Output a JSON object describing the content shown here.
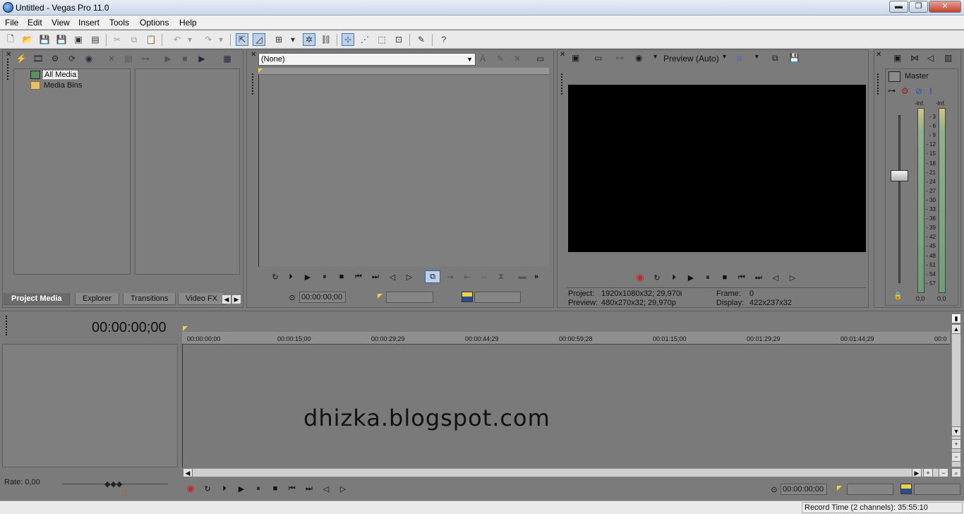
{
  "window": {
    "title": "Untitled - Vegas Pro 11.0",
    "minimize": "▬",
    "maximize": "❐",
    "close": "✕"
  },
  "menu": [
    "File",
    "Edit",
    "View",
    "Insert",
    "Tools",
    "Options",
    "Help"
  ],
  "explorer": {
    "tree": [
      "All Media",
      "Media Bins"
    ],
    "tabs": [
      "Project Media",
      "Explorer",
      "Transitions",
      "Video FX"
    ]
  },
  "trimmer": {
    "clip_select": "(None)",
    "timecode": "00:00:00;00"
  },
  "preview": {
    "quality": "Preview (Auto)",
    "project_label": "Project:",
    "project_value": "1920x1080x32; 29,970i",
    "preview_label": "Preview:",
    "preview_value": "480x270x32; 29,970p",
    "frame_label": "Frame:",
    "frame_value": "0",
    "display_label": "Display:",
    "display_value": "422x237x32"
  },
  "mixer": {
    "master": "Master",
    "inf_left": "-Inf.",
    "inf_right": "-Inf.",
    "db_ticks": [
      "3",
      "6",
      "9",
      "12",
      "15",
      "18",
      "21",
      "24",
      "27",
      "30",
      "33",
      "36",
      "39",
      "42",
      "45",
      "48",
      "51",
      "54",
      "57"
    ],
    "left_value": "0,0",
    "right_value": "0,0"
  },
  "timeline": {
    "timecode": "00:00:00;00",
    "ruler": [
      "00:00:00;00",
      "00:00:15;00",
      "00:00:29;29",
      "00:00:44;29",
      "00:00:59;28",
      "00:01:15;00",
      "00:01:29;29",
      "00:01:44;29",
      "00:0"
    ],
    "watermark": "dhizka.blogspot.com",
    "rate": "Rate: 0,00",
    "transport_time": "00:00:00;00"
  },
  "status": {
    "record_time": "Record Time (2 channels): 35:55:10"
  },
  "colors": {
    "panel": "#7a7a7a",
    "accent": "#4b77b3",
    "record": "#c0282a"
  }
}
